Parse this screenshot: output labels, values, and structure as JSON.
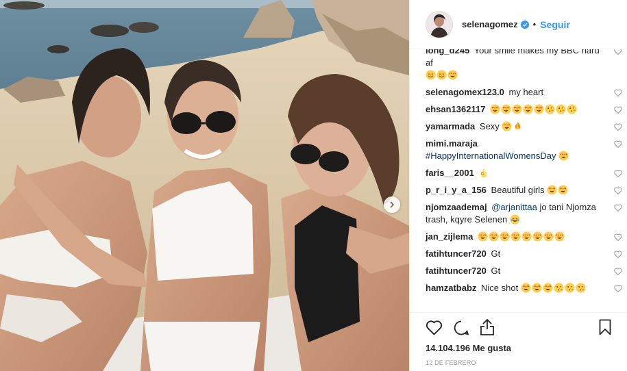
{
  "post": {
    "username": "selenagomez",
    "separator": "•",
    "follow_label": "Seguir",
    "likes_text": "14.104.196 Me gusta",
    "date_text": "12 DE FEBRERO"
  },
  "icons": {
    "verified": "verified-badge-icon",
    "next": "chevron-right-icon",
    "like": "heart-icon",
    "comment": "comment-icon",
    "share": "share-icon",
    "save": "bookmark-icon"
  },
  "colors": {
    "link": "#3897f0",
    "mention": "#003569",
    "verified": "#3897f0",
    "emoji_face": "#ffcc4d",
    "emoji_heart": "#dd2e44"
  },
  "comments": [
    {
      "user": "long_d245",
      "text": "Your smile makes my BBC hard af",
      "emojis": [
        "grin",
        "grin",
        "hearteyes"
      ]
    },
    {
      "user": "selenagomex123.0",
      "text": "my heart",
      "emojis": []
    },
    {
      "user": "ehsan1362117",
      "text": "",
      "emojis": [
        "hearteyes",
        "hearteyes",
        "hearteyes",
        "hearteyes",
        "hearteyes",
        "kiss",
        "kiss",
        "kiss"
      ]
    },
    {
      "user": "yamarmada",
      "text": "Sexy",
      "emojis": [
        "hearteyes",
        "fire"
      ]
    },
    {
      "user": "mimi.maraja",
      "text": "",
      "hashtag": "#HappyInternationalWomensDay",
      "emojis": [
        "hearteyes"
      ]
    },
    {
      "user": "faris__2001",
      "text": "",
      "emojis": [
        "ok"
      ]
    },
    {
      "user": "p_r_i_y_a_156",
      "text": "Beautiful girls",
      "emojis": [
        "hearteyes",
        "hearteyes"
      ]
    },
    {
      "user": "njomzaademaj",
      "mention": "@arjanittaa",
      "text": "jo tani Njomza trash, kqyre Selenen",
      "emojis": [
        "laugh"
      ]
    },
    {
      "user": "jan_zijlema",
      "text": "",
      "emojis": [
        "hearteyes",
        "hearteyes",
        "hearteyes",
        "hearteyes",
        "hearteyes",
        "hearteyes",
        "hearteyes",
        "hearteyes"
      ]
    },
    {
      "user": "fatihtuncer720",
      "text": "Gt",
      "emojis": []
    },
    {
      "user": "fatihtuncer720",
      "text": "Gt",
      "emojis": []
    },
    {
      "user": "hamzatbabz",
      "text": "Nice shot",
      "emojis": [
        "hearteyes",
        "hearteyes",
        "hearteyes",
        "kiss",
        "kiss",
        "kiss"
      ]
    }
  ]
}
